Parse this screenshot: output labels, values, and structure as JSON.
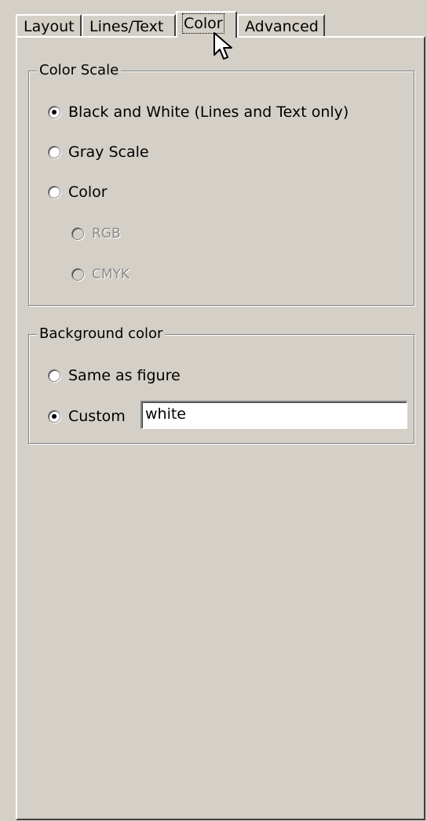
{
  "tabs": [
    {
      "label": "Layout",
      "active": false
    },
    {
      "label": "Lines/Text",
      "active": false
    },
    {
      "label": "Color",
      "active": true
    },
    {
      "label": "Advanced",
      "active": false
    }
  ],
  "color_scale": {
    "title": "Color Scale",
    "options": [
      {
        "label": "Black and White (Lines and Text only)",
        "selected": true,
        "enabled": true
      },
      {
        "label": "Gray Scale",
        "selected": false,
        "enabled": true
      },
      {
        "label": "Color",
        "selected": false,
        "enabled": true
      },
      {
        "label": "RGB",
        "selected": false,
        "enabled": false
      },
      {
        "label": "CMYK",
        "selected": false,
        "enabled": false
      }
    ]
  },
  "background_color": {
    "title": "Background color",
    "options": [
      {
        "label": "Same as figure",
        "selected": false
      },
      {
        "label": "Custom",
        "selected": true
      }
    ],
    "custom_value": "white"
  },
  "cursor": {
    "icon": "mouse-pointer-icon"
  },
  "colors": {
    "face": "#d4d0c8",
    "highlight": "#ffffff",
    "shadow": "#808080",
    "dark_shadow": "#404040",
    "disabled_text": "#8a8a8a"
  }
}
